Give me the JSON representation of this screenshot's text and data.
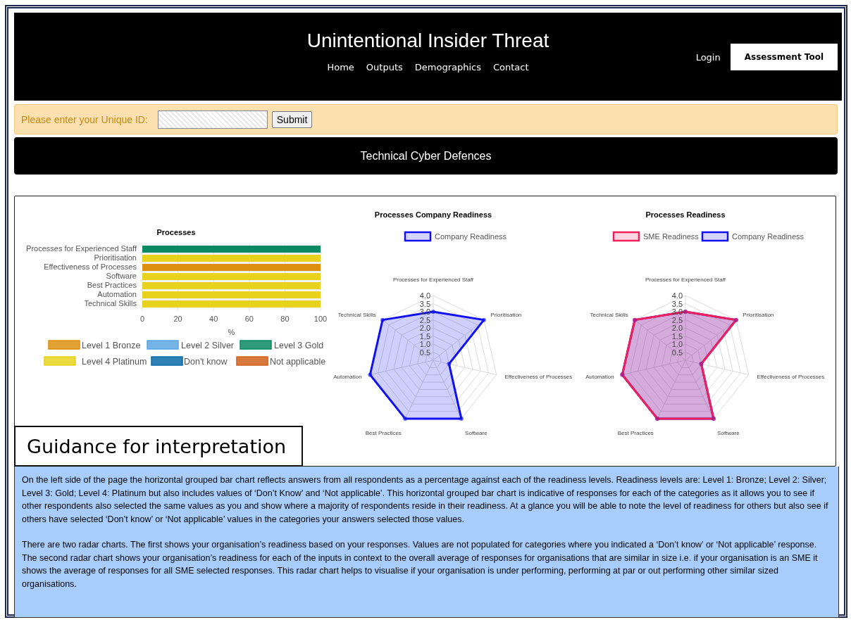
{
  "header": {
    "title": "Unintentional Insider Threat",
    "nav": [
      "Home",
      "Outputs",
      "Demographics",
      "Contact"
    ],
    "login": "Login",
    "cta": "Assessment Tool"
  },
  "id_bar": {
    "label": "Please enter your Unique ID:",
    "submit": "Submit"
  },
  "section_title": "Technical Cyber Defences",
  "bar_chart": {
    "chart_data": {
      "type": "bar",
      "orientation": "horizontal",
      "stacked": true,
      "grid": true,
      "legend": true,
      "title": "Processes",
      "xlabel": "%",
      "categories": [
        "Processes for Experienced Staff",
        "Prioritisation",
        "Effectiveness of Processes",
        "Software",
        "Best Practices",
        "Automation",
        "Technical Skills"
      ],
      "xlim": [
        0,
        100
      ],
      "xticks": [
        0,
        20,
        40,
        60,
        80,
        100
      ],
      "series": [
        {
          "name": "Level 1 Bronze",
          "color": "#dd9010",
          "values": [
            0,
            0,
            100,
            0,
            0,
            0,
            0
          ]
        },
        {
          "name": "Level 2 Silver",
          "color": "#5aa6e0",
          "values": [
            0,
            0,
            0,
            0,
            0,
            0,
            0
          ]
        },
        {
          "name": "Level 3 Gold",
          "color": "#0a8a60",
          "values": [
            100,
            0,
            0,
            0,
            0,
            0,
            0
          ]
        },
        {
          "name": "Level 4 Platinum",
          "color": "#e8d21e",
          "values": [
            0,
            100,
            0,
            100,
            100,
            100,
            100
          ]
        },
        {
          "name": "Don't know",
          "color": "#0a6aa8",
          "values": [
            0,
            0,
            0,
            0,
            0,
            0,
            0
          ]
        },
        {
          "name": "Not applicable",
          "color": "#d0621a",
          "values": [
            0,
            0,
            0,
            0,
            0,
            0,
            0
          ]
        }
      ]
    }
  },
  "radar_charts": [
    {
      "title": "Processes Company Readiness",
      "axes": [
        "Processes for Experienced Staff",
        "Prioritisation",
        "Effectiveness of Processes",
        "Software",
        "Best Practices",
        "Automation",
        "Technical Skills"
      ],
      "scale": [
        "4.0",
        "3.5",
        "3.0",
        "2.5",
        "2.0",
        "1.5",
        "1.0",
        "0.5"
      ],
      "series": [
        {
          "name": "Company Readiness",
          "color": "#1010f0"
        }
      ]
    },
    {
      "title": "Processes Readiness",
      "axes": [
        "Processes for Experienced Staff",
        "Prioritisation",
        "Effectiveness of Processes",
        "Software",
        "Best Practices",
        "Automation",
        "Technical Skills"
      ],
      "scale": [
        "4.0",
        "3.5",
        "3.0",
        "2.5",
        "2.0",
        "1.5",
        "1.0",
        "0.5"
      ],
      "series": [
        {
          "name": "SME Readiness",
          "color": "#f0205a"
        },
        {
          "name": "Company Readiness",
          "color": "#1010f0"
        }
      ]
    }
  ],
  "guidance": {
    "heading": "Guidance for interpretation",
    "paragraphs": [
      "On the left side of the page the horizontal grouped bar chart reflects answers from all respondents as a percentage against each of the readiness levels. Readiness levels are: Level 1: Bronze; Level 2: Silver; Level 3: Gold; Level 4: Platinum but also includes values of ‘Don’t Know’ and ‘Not applicable’. This horizontal grouped bar chart is indicative of responses for each of the categories as it allows you to see if other respondents also selected the same values as you and show where a majority of respondents reside in their readiness. At a glance you will be able to note the level of readiness for others but also see if others have selected ‘Don’t know’ or ‘Not applicable’ values in the categories your answers selected those values.",
      "There are two radar charts. The first shows your organisation’s readiness based on your responses. Values are not populated for categories where you indicated a ‘Don’t know’ or ‘Not applicable’ response. The second radar chart shows your organisation’s readiness for each of the inputs in context to the overall average of responses for organisations that are similar in size i.e. if your organisation is an SME it shows the average of responses for all SME selected responses. This radar chart helps to visualise if your organisation is under performing, performing at par or out performing other similar sized organisations."
    ]
  }
}
